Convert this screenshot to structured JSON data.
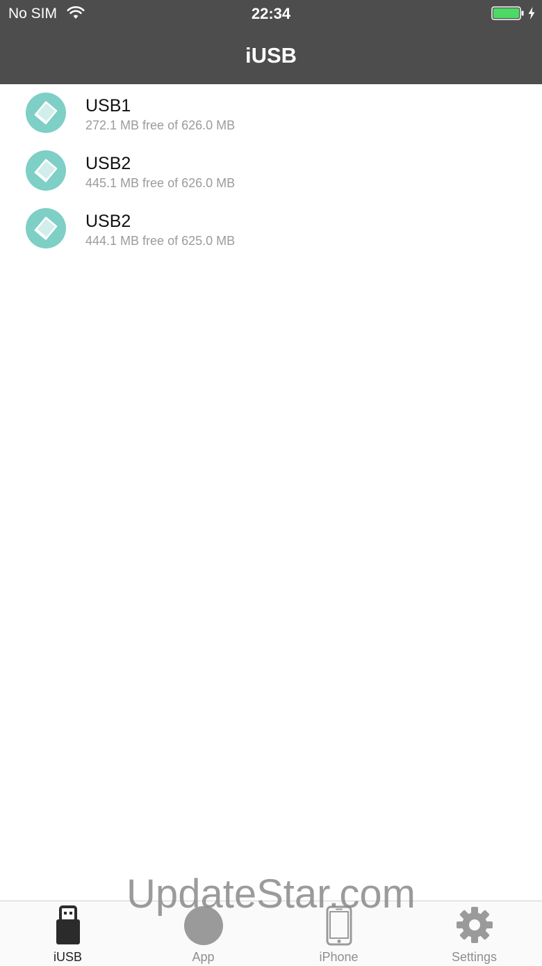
{
  "status_bar": {
    "carrier": "No SIM",
    "time": "22:34",
    "battery_color": "#4cd964"
  },
  "nav": {
    "title": "iUSB"
  },
  "drives": [
    {
      "name": "USB1",
      "space": "272.1 MB free of 626.0 MB"
    },
    {
      "name": "USB2",
      "space": "445.1 MB free of 626.0 MB"
    },
    {
      "name": "USB2",
      "space": "444.1 MB free of 625.0 MB"
    }
  ],
  "watermark": "UpdateStar.com",
  "tabs": [
    {
      "label": "iUSB",
      "icon": "usb-drive-icon",
      "active": true
    },
    {
      "label": "App",
      "icon": "app-circle-icon",
      "active": false
    },
    {
      "label": "iPhone",
      "icon": "iphone-icon",
      "active": false
    },
    {
      "label": "Settings",
      "icon": "gear-icon",
      "active": false
    }
  ],
  "colors": {
    "header": "#4d4d4d",
    "drive_icon": "#7ecfc6",
    "subtitle": "#9b9b9b"
  }
}
